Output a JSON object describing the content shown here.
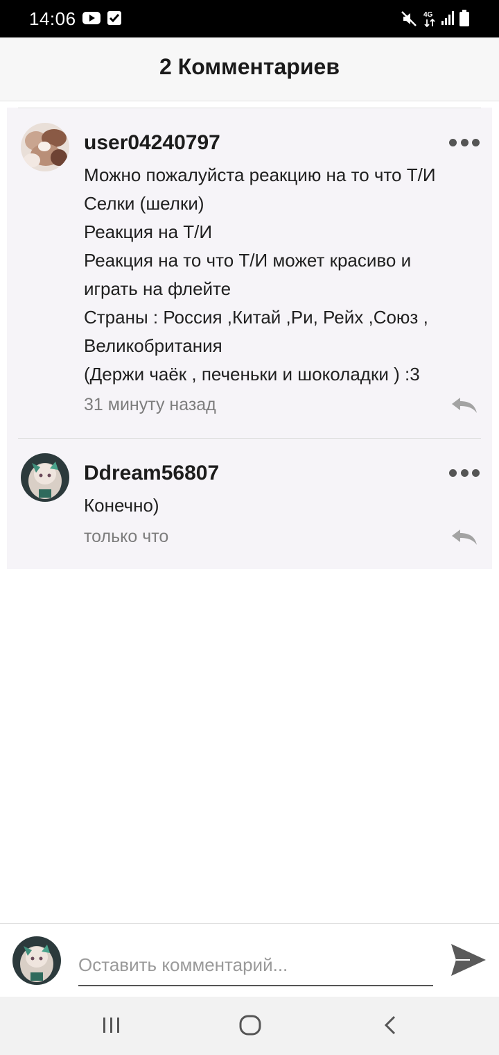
{
  "status_bar": {
    "time": "14:06"
  },
  "header": {
    "title": "2 Комментариев"
  },
  "comments": [
    {
      "username": "user04240797",
      "lines": [
        "Можно пожалуйста реакцию на то что Т/И",
        "Селки (шелки)",
        "Реакция на Т/И",
        "Реакция на то что Т/И может красиво и",
        "играть на флейте",
        "Страны : Россия ,Китай ,Ри, Рейх ,Союз ,",
        "Великобритания",
        "(Держи чаёк , печеньки и шоколадки ) :3"
      ],
      "time": "31 минуту назад"
    },
    {
      "username": "Ddream56807",
      "lines": [
        "Конечно)"
      ],
      "time": "только что"
    }
  ],
  "composer": {
    "placeholder": "Оставить комментарий..."
  },
  "icons": {
    "more": "more-dots-icon",
    "reply": "reply-arrow-icon",
    "send": "send-icon",
    "nav": [
      "recents-icon",
      "home-icon",
      "back-icon"
    ]
  },
  "colors": {
    "panel": "#f6f4f8",
    "text": "#202020",
    "muted": "#7d7d7d",
    "icon": "#555555"
  }
}
